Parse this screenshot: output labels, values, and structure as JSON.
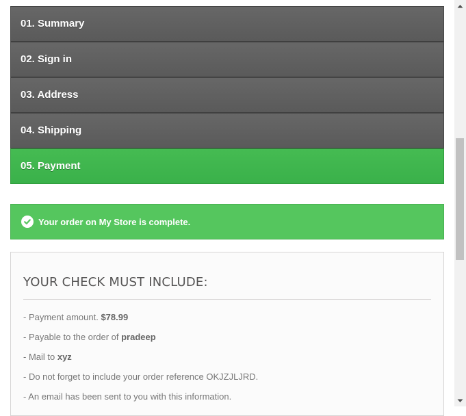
{
  "steps": [
    {
      "label": "01. Summary"
    },
    {
      "label": "02. Sign in"
    },
    {
      "label": "03. Address"
    },
    {
      "label": "04. Shipping"
    },
    {
      "label": "05. Payment"
    }
  ],
  "alert": {
    "text": "Your order on My Store is complete.",
    "icon": "check-circle-icon",
    "color": "#55c65e"
  },
  "check_box": {
    "title": "YOUR CHECK MUST INCLUDE:",
    "lines": [
      {
        "prefix": "- Payment amount. ",
        "value": "$78.99",
        "suffix": ""
      },
      {
        "prefix": "- Payable to the order of ",
        "value": "pradeep",
        "suffix": ""
      },
      {
        "prefix": "- Mail to ",
        "value": "xyz",
        "suffix": ""
      },
      {
        "prefix": "- Do not forget to include your order reference OKJZJLJRD.",
        "value": "",
        "suffix": ""
      },
      {
        "prefix": "- An email has been sent to you with this information.",
        "value": "",
        "suffix": ""
      }
    ]
  },
  "colors": {
    "step_bg": "#5f5f5f",
    "step_active_bg": "#3fb64e",
    "box_border": "#d6d4d4"
  }
}
